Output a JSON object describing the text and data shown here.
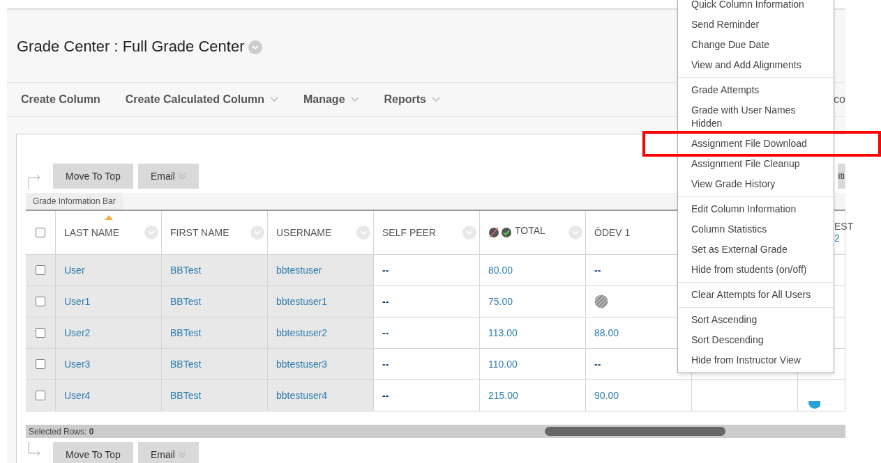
{
  "page": {
    "title": "Grade Center : Full Grade Center"
  },
  "toolbar": [
    {
      "label": "Create Column",
      "dropdown": false
    },
    {
      "label": "Create Calculated Column",
      "dropdown": true
    },
    {
      "label": "Manage",
      "dropdown": true
    },
    {
      "label": "Reports",
      "dropdown": true
    },
    {
      "label": "co",
      "dropdown": false
    }
  ],
  "action_bar_top": {
    "buttons": [
      {
        "label": "Move To Top",
        "dropdown": false
      },
      {
        "label": "Email",
        "dropdown": true
      }
    ],
    "right_fragment": "iti"
  },
  "grade_information_bar": "Grade Information Bar",
  "table": {
    "select_all_checked": false,
    "columns": [
      {
        "kind": "menu",
        "label": "LAST NAME",
        "sorted": true
      },
      {
        "kind": "menu",
        "label": "FIRST NAME"
      },
      {
        "kind": "menu",
        "label": "USERNAME"
      },
      {
        "kind": "menu",
        "label": "SELF PEER"
      },
      {
        "kind": "total",
        "label": "TOTAL"
      },
      {
        "kind": "plain",
        "label": "ÖDEV 1"
      },
      {
        "kind": "blank"
      },
      {
        "kind": "two_line",
        "label": "EST",
        "label_2": "2"
      }
    ],
    "rows": [
      {
        "checked": false,
        "last_name": "User",
        "first_name": "BBTest",
        "username": "bbtestuser",
        "self_peer": "--",
        "total": "80.00",
        "odev_1": {
          "kind": "empty",
          "text": "--"
        },
        "column_9": {
          "kind": "none"
        }
      },
      {
        "checked": false,
        "last_name": "User1",
        "first_name": "BBTest",
        "username": "bbtestuser1",
        "self_peer": "--",
        "total": "75.00",
        "odev_1": {
          "kind": "in_progress"
        },
        "column_9": {
          "kind": "none"
        }
      },
      {
        "checked": false,
        "last_name": "User2",
        "first_name": "BBTest",
        "username": "bbtestuser2",
        "self_peer": "--",
        "total": "113.00",
        "odev_1": {
          "kind": "grade",
          "text": "88.00"
        },
        "column_9": {
          "kind": "none"
        }
      },
      {
        "checked": false,
        "last_name": "User3",
        "first_name": "BBTest",
        "username": "bbtestuser3",
        "self_peer": "--",
        "total": "110.00",
        "odev_1": {
          "kind": "empty",
          "text": "--"
        },
        "column_9": {
          "kind": "none"
        }
      },
      {
        "checked": false,
        "last_name": "User4",
        "first_name": "BBTest",
        "username": "bbtestuser4",
        "self_peer": "--",
        "total": "215.00",
        "odev_1": {
          "kind": "grade",
          "text": "90.00"
        },
        "column_9": {
          "kind": "dot"
        }
      }
    ]
  },
  "selected_rows": {
    "label": "Selected Rows:",
    "count": "0"
  },
  "action_bar_bottom": {
    "buttons": [
      {
        "label": "Move To Top",
        "dropdown": false
      },
      {
        "label": "Email",
        "dropdown": true
      }
    ]
  },
  "context_menu": {
    "groups": [
      {
        "items": [
          {
            "label": "Quick Column Information",
            "highlighted": false
          },
          {
            "label": "Send Reminder",
            "highlighted": false
          },
          {
            "label": "Change Due Date",
            "highlighted": false
          },
          {
            "label": "View and Add Alignments",
            "highlighted": false
          }
        ]
      },
      {
        "items": [
          {
            "label": "Grade Attempts",
            "highlighted": false
          },
          {
            "label": "Grade with User Names Hidden",
            "highlighted": false
          },
          {
            "label": "Assignment File Download",
            "highlighted": true
          },
          {
            "label": "Assignment File Cleanup",
            "highlighted": false
          },
          {
            "label": "View Grade History",
            "highlighted": false
          }
        ]
      },
      {
        "items": [
          {
            "label": "Edit Column Information",
            "highlighted": false
          },
          {
            "label": "Column Statistics",
            "highlighted": false
          },
          {
            "label": "Set as External Grade",
            "highlighted": false
          },
          {
            "label": "Hide from students (on/off)",
            "highlighted": false
          }
        ]
      },
      {
        "items": [
          {
            "label": "Clear Attempts for All Users",
            "highlighted": false
          }
        ]
      },
      {
        "items": [
          {
            "label": "Sort Ascending",
            "highlighted": false
          },
          {
            "label": "Sort Descending",
            "highlighted": false
          },
          {
            "label": "Hide from Instructor View",
            "highlighted": false
          }
        ]
      }
    ]
  }
}
